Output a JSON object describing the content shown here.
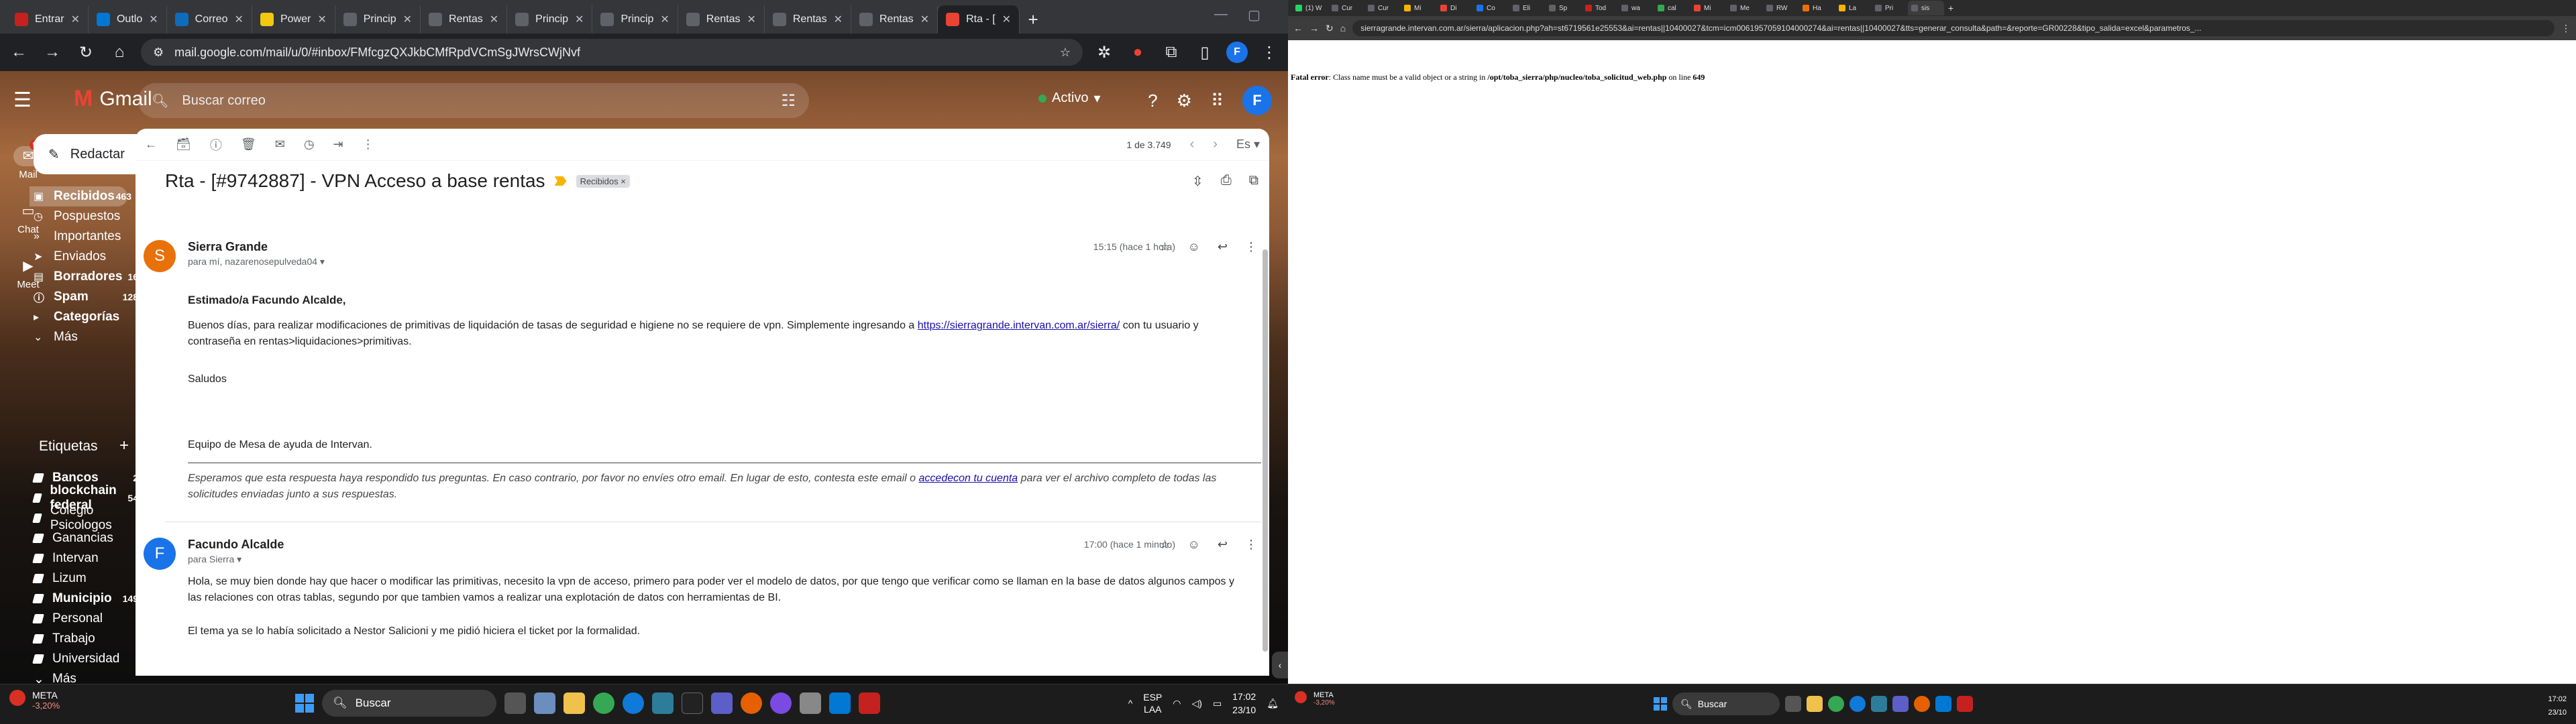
{
  "left_browser": {
    "tabs": [
      {
        "label": "Entrar",
        "color": "#c5221f"
      },
      {
        "label": "Outlo",
        "color": "#0078d4"
      },
      {
        "label": "Correo",
        "color": "#0f6cbd"
      },
      {
        "label": "Power",
        "color": "#f2c811"
      },
      {
        "label": "Princip",
        "color": "#5f6368"
      },
      {
        "label": "Rentas",
        "color": "#5f6368"
      },
      {
        "label": "Princip",
        "color": "#5f6368"
      },
      {
        "label": "Princip",
        "color": "#5f6368"
      },
      {
        "label": "Rentas",
        "color": "#5f6368"
      },
      {
        "label": "Rentas",
        "color": "#5f6368"
      },
      {
        "label": "Rentas",
        "color": "#5f6368"
      },
      {
        "label": "Rta - [",
        "color": "#ea4335"
      }
    ],
    "url": "mail.google.com/mail/u/0/#inbox/FMfcgzQXJkbCMfRpdVCmSgJWrsCWjNvf"
  },
  "gmail": {
    "brand": "Gmail",
    "search_placeholder": "Buscar correo",
    "status": "Activo",
    "account_initial": "F",
    "rail": [
      {
        "label": "Mail",
        "badge": "99+"
      },
      {
        "label": "Chat"
      },
      {
        "label": "Meet"
      }
    ],
    "compose_label": "Redactar",
    "nav": [
      {
        "label": "Recibidos",
        "count": "463"
      },
      {
        "label": "Pospuestos",
        "count": ""
      },
      {
        "label": "Importantes",
        "count": ""
      },
      {
        "label": "Enviados",
        "count": ""
      },
      {
        "label": "Borradores",
        "count": "16"
      },
      {
        "label": "Spam",
        "count": "128"
      },
      {
        "label": "Categorías",
        "count": ""
      },
      {
        "label": "Más",
        "count": ""
      }
    ],
    "labels_title": "Etiquetas",
    "labels": [
      {
        "label": "Bancos",
        "count": "2"
      },
      {
        "label": "blockchain federal",
        "count": "54"
      },
      {
        "label": "Colegio Psicologos",
        "count": ""
      },
      {
        "label": "Ganancias",
        "count": ""
      },
      {
        "label": "Intervan",
        "count": ""
      },
      {
        "label": "Lizum",
        "count": ""
      },
      {
        "label": "Municipio",
        "count": "149"
      },
      {
        "label": "Personal",
        "count": ""
      },
      {
        "label": "Trabajo",
        "count": ""
      },
      {
        "label": "Universidad",
        "count": ""
      },
      {
        "label": "Más",
        "count": ""
      }
    ],
    "pager": "1 de 3.749",
    "lang": "Es",
    "subject": "Rta - [#9742887] - VPN Acceso a base rentas",
    "inbox_chip": "Recibidos ×",
    "messages": [
      {
        "initial": "S",
        "avatar_color": "#e8710a",
        "sender": "Sierra Grande",
        "to": "para mí, nazarenosepulveda04",
        "time": "15:15 (hace 1 hora)",
        "greeting": "Estimado/a Facundo Alcalde,",
        "p1_a": "Buenos días, para realizar modificaciones de primitivas de liquidación de tasas de seguridad e higiene no se requiere de vpn. Simplemente ingresando a",
        "p1_link": "https://sierragrande.intervan.com.ar/sierra/",
        "p1_b": "con tu usuario y contraseña en rentas>liquidaciones>primitivas.",
        "saludos": "Saludos",
        "signature": "Equipo de Mesa de ayuda de Intervan.",
        "footer_a": "Esperamos que esta respuesta haya respondido tus preguntas. En caso contrario, por favor no envíes otro email. En lugar de esto, contesta este email o",
        "footer_link": "accedecon tu cuenta",
        "footer_b": "para ver el archivo completo de todas las solicitudes enviadas junto a sus respuestas."
      },
      {
        "initial": "F",
        "avatar_color": "#1a73e8",
        "sender": "Facundo Alcalde",
        "to": "para Sierra",
        "time": "17:00 (hace 1 minuto)",
        "p1": "Hola, se muy bien donde hay que hacer o modificar las primitivas, necesito la vpn de acceso, primero para poder ver el modelo de datos, por que tengo que verificar como se llaman en la base de datos algunos campos y las relaciones con otras tablas, segundo por que tambien vamos a realizar una explotación de datos con herramientas de BI.",
        "p2": "El tema ya se lo había solicitado a Nestor Salicioni y me pidió hiciera el ticket por la formalidad."
      }
    ]
  },
  "left_taskbar": {
    "weather_title": "META",
    "weather_value": "-3,20%",
    "search": "Buscar",
    "lang1": "ESP",
    "lang2": "LAA",
    "time": "17:02",
    "date": "23/10"
  },
  "right_browser": {
    "tabs": [
      "(1) W",
      "Cur",
      "Cur",
      "Mi",
      "Di",
      "Co",
      "Eli",
      "Sp",
      "Tod",
      "wa",
      "cal",
      "Mi",
      "Me",
      "RW",
      "Ha",
      "La",
      "Pri",
      "sis"
    ],
    "url": "sierragrande.intervan.com.ar/sierra/aplicacion.php?ah=st6719561e25553&ai=rentas||10400027&tcm=icm0061957059104000274&ai=rentas||10400027&tts=generar_consulta&path=&reporte=GR00228&tipo_salida=excel&parametros_...",
    "error_label": "Fatal error",
    "error_text": ": Class name must be a valid object or a string in",
    "error_path": "/opt/toba_sierra/php/nucleo/toba_solicitud_web.php",
    "error_line_label": "on line",
    "error_line": "649"
  },
  "right_taskbar": {
    "weather_title": "META",
    "weather_value": "-3,20%",
    "search": "Buscar",
    "time": "17:02",
    "date": "23/10"
  }
}
